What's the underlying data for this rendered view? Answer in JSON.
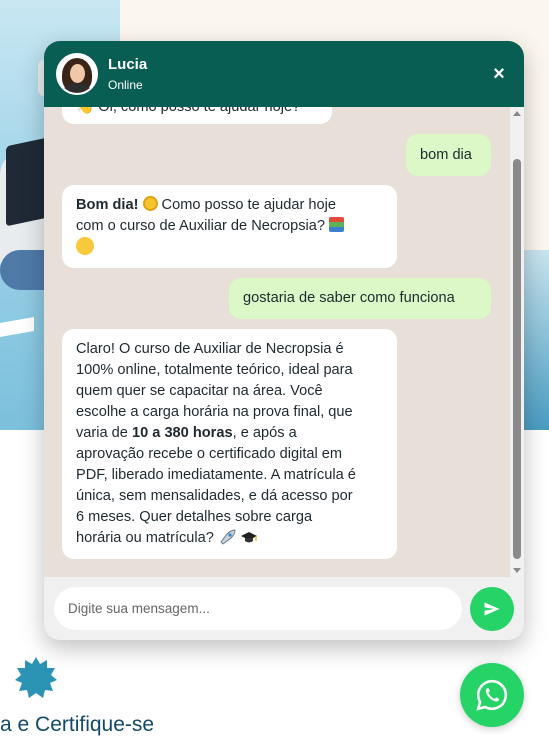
{
  "page": {
    "heading": "a e Certifique-se"
  },
  "chat": {
    "agent_name": "Lucia",
    "agent_status": "Online",
    "close_label": "×",
    "messages": [
      {
        "from": "agent",
        "text": "👋 Oi, como posso te ajudar hoje?"
      },
      {
        "from": "user",
        "text": "bom dia"
      },
      {
        "from": "agent",
        "bold": "Bom dia!",
        "text_a": " Como posso te ajudar hoje",
        "text_b": "com o curso de Auxiliar de Necropsia?"
      },
      {
        "from": "user",
        "text": "gostaria de saber como funciona"
      },
      {
        "from": "agent",
        "lines": [
          "Claro! O curso de Auxiliar de Necropsia é",
          "100% online, totalmente teórico, ideal para",
          "quem quer se capacitar na área. Você",
          "escolhe a carga horária na prova final, que"
        ],
        "line5_pre": "varia de ",
        "line5_bold": "10 a 380 horas",
        "line5_post": ", e após a",
        "lines_after": [
          "aprovação recebe o certificado digital em",
          "PDF, liberado imediatamente. A matrícula é",
          "única, sem mensalidades, e dá acesso por",
          "6 meses. Quer detalhes sobre carga",
          "horária ou matrícula?"
        ]
      }
    ],
    "input_placeholder": "Digite sua mensagem...",
    "icons": {
      "send": "send-icon",
      "whatsapp": "whatsapp-icon",
      "close": "close-icon"
    },
    "colors": {
      "header": "#095e54",
      "chat_bg": "#e8e0d8",
      "user_bubble": "#dbf8c6",
      "send": "#25d366"
    }
  }
}
